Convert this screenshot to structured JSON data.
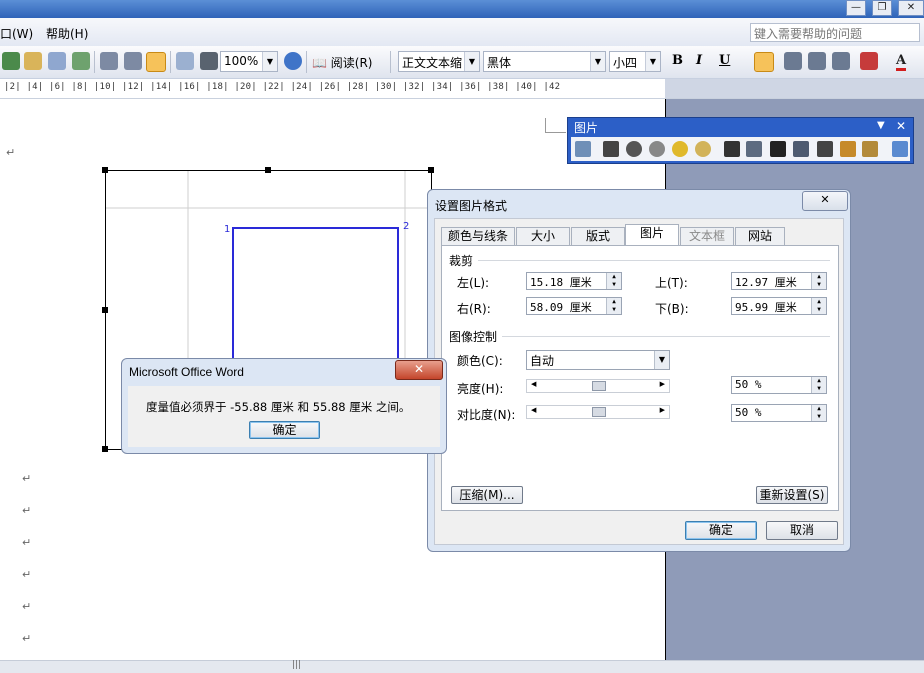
{
  "menubar": {
    "items": [
      "口(W)",
      "帮助(H)"
    ],
    "help_placeholder": "键入需要帮助的问题",
    "window_controls": [
      "—",
      "❐",
      "✕"
    ]
  },
  "toolbar": {
    "zoom": "100%",
    "read_label": "阅读(R)",
    "style": "正文文本缩",
    "font": "黑体",
    "size": "小四",
    "bold": "B",
    "italic": "I",
    "underline": "U",
    "font_color_letter": "A"
  },
  "ruler": {
    "ticks": "|2|  |4|  |6|  |8|  |10|  |12|  |14|  |16|  |18|  |20|  |22|  |24|  |26|  |28|  |30|  |32|  |34|  |36|  |38|  |40|  |42"
  },
  "document": {
    "paragraph_mark": "↵",
    "corner_labels": [
      "1",
      "2"
    ]
  },
  "picture_toolbar": {
    "title": "图片",
    "icons": [
      "insert-picture-icon",
      "color-icon",
      "more-contrast-icon",
      "less-contrast-icon",
      "more-brightness-icon",
      "less-brightness-icon",
      "crop-icon",
      "rotate-icon",
      "line-style-icon",
      "compress-icon",
      "text-wrap-icon",
      "format-picture-icon",
      "set-transparent-icon",
      "reset-picture-icon"
    ]
  },
  "format_dialog": {
    "title": "设置图片格式",
    "close": "✕",
    "tabs": [
      "颜色与线条",
      "大小",
      "版式",
      "图片",
      "文本框",
      "网站"
    ],
    "active_tab": "图片",
    "crop": {
      "group": "裁剪",
      "left_label": "左(L):",
      "left_value": "15.18 厘米",
      "top_label": "上(T):",
      "top_value": "12.97 厘米",
      "right_label": "右(R):",
      "right_value": "58.09 厘米",
      "bottom_label": "下(B):",
      "bottom_value": "95.99 厘米"
    },
    "image_control": {
      "group": "图像控制",
      "color_label": "颜色(C):",
      "color_value": "自动",
      "brightness_label": "亮度(H):",
      "brightness_value": "50 %",
      "contrast_label": "对比度(N):",
      "contrast_value": "50 %"
    },
    "compress_button": "压缩(M)...",
    "reset_button": "重新设置(S)",
    "ok_button": "确定",
    "cancel_button": "取消"
  },
  "message_box": {
    "title": "Microsoft Office Word",
    "close": "✕",
    "message": "度量值必须界于 -55.88 厘米 和 55.88 厘米 之间。",
    "ok_button": "确定"
  },
  "colors": {
    "title_blue": "#2c5fc7",
    "highlight_orange": "#f6c25a",
    "picture_line": "#2a2ad8",
    "gray_area": "#8f9bb8"
  }
}
